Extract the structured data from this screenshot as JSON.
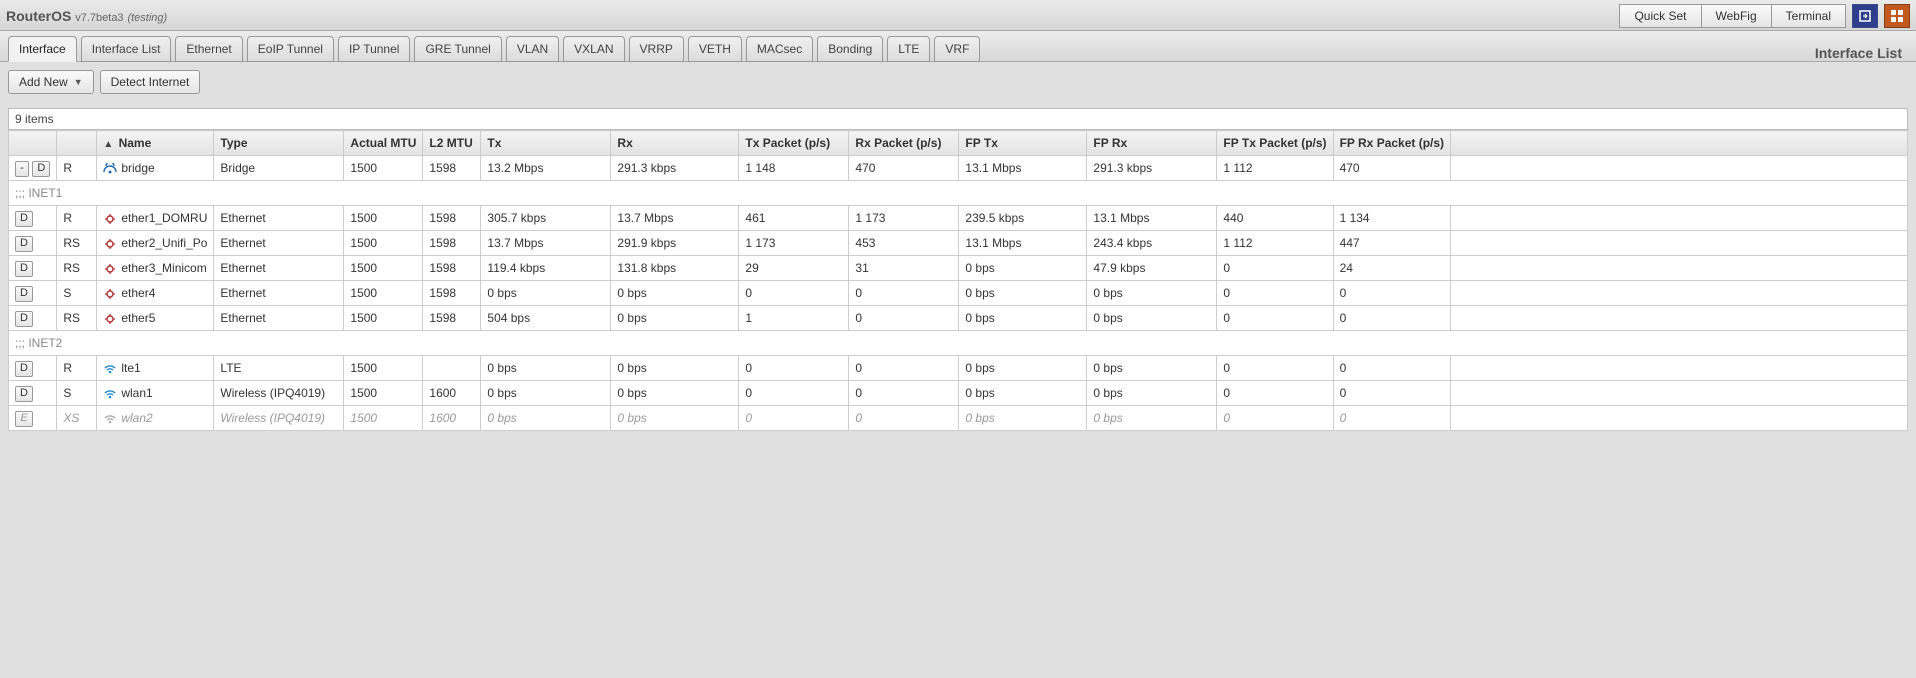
{
  "brand_name": "RouterOS",
  "brand_ver": "v7.7beta3",
  "brand_tag": "(testing)",
  "topbuttons": [
    "Quick Set",
    "WebFig",
    "Terminal"
  ],
  "page_title": "Interface List",
  "tabs": [
    "Interface",
    "Interface List",
    "Ethernet",
    "EoIP Tunnel",
    "IP Tunnel",
    "GRE Tunnel",
    "VLAN",
    "VXLAN",
    "VRRP",
    "VETH",
    "MACsec",
    "Bonding",
    "LTE",
    "VRF"
  ],
  "active_tab": 0,
  "toolbar": {
    "addnew": "Add New",
    "detect": "Detect Internet"
  },
  "count_label": "9 items",
  "columns": [
    "",
    "",
    "▲ Name",
    "Type",
    "Actual MTU",
    "L2 MTU",
    "Tx",
    "Rx",
    "Tx Packet (p/s)",
    "Rx Packet (p/s)",
    "FP Tx",
    "FP Rx",
    "FP Tx Packet (p/s)",
    "FP Rx Packet (p/s)",
    ""
  ],
  "sections": [
    {
      "rows": [
        {
          "flags": [
            "-",
            "D"
          ],
          "stat": "R",
          "icon": "bridge",
          "name": "bridge",
          "type": "Bridge",
          "amtu": "1500",
          "l2mtu": "1598",
          "tx": "13.2 Mbps",
          "rx": "291.3 kbps",
          "txp": "1 148",
          "rxp": "470",
          "fptx": "13.1 Mbps",
          "fprx": "291.3 kbps",
          "fptxp": "1 112",
          "fprxp": "470",
          "disabled": false
        }
      ]
    },
    {
      "label": ";;; INET1",
      "rows": [
        {
          "flags": [
            "D"
          ],
          "stat": "R",
          "icon": "eth",
          "name": "ether1_DOMRU",
          "type": "Ethernet",
          "amtu": "1500",
          "l2mtu": "1598",
          "tx": "305.7 kbps",
          "rx": "13.7 Mbps",
          "txp": "461",
          "rxp": "1 173",
          "fptx": "239.5 kbps",
          "fprx": "13.1 Mbps",
          "fptxp": "440",
          "fprxp": "1 134",
          "disabled": false
        },
        {
          "flags": [
            "D"
          ],
          "stat": "RS",
          "icon": "eth",
          "name": "ether2_Unifi_Po",
          "type": "Ethernet",
          "amtu": "1500",
          "l2mtu": "1598",
          "tx": "13.7 Mbps",
          "rx": "291.9 kbps",
          "txp": "1 173",
          "rxp": "453",
          "fptx": "13.1 Mbps",
          "fprx": "243.4 kbps",
          "fptxp": "1 112",
          "fprxp": "447",
          "disabled": false
        },
        {
          "flags": [
            "D"
          ],
          "stat": "RS",
          "icon": "eth",
          "name": "ether3_Minicom",
          "type": "Ethernet",
          "amtu": "1500",
          "l2mtu": "1598",
          "tx": "119.4 kbps",
          "rx": "131.8 kbps",
          "txp": "29",
          "rxp": "31",
          "fptx": "0 bps",
          "fprx": "47.9 kbps",
          "fptxp": "0",
          "fprxp": "24",
          "disabled": false
        },
        {
          "flags": [
            "D"
          ],
          "stat": "S",
          "icon": "eth",
          "name": "ether4",
          "type": "Ethernet",
          "amtu": "1500",
          "l2mtu": "1598",
          "tx": "0 bps",
          "rx": "0 bps",
          "txp": "0",
          "rxp": "0",
          "fptx": "0 bps",
          "fprx": "0 bps",
          "fptxp": "0",
          "fprxp": "0",
          "disabled": false
        },
        {
          "flags": [
            "D"
          ],
          "stat": "RS",
          "icon": "eth",
          "name": "ether5",
          "type": "Ethernet",
          "amtu": "1500",
          "l2mtu": "1598",
          "tx": "504 bps",
          "rx": "0 bps",
          "txp": "1",
          "rxp": "0",
          "fptx": "0 bps",
          "fprx": "0 bps",
          "fptxp": "0",
          "fprxp": "0",
          "disabled": false
        }
      ]
    },
    {
      "label": ";;; INET2",
      "rows": [
        {
          "flags": [
            "D"
          ],
          "stat": "R",
          "icon": "wl",
          "name": "lte1",
          "type": "LTE",
          "amtu": "1500",
          "l2mtu": "",
          "tx": "0 bps",
          "rx": "0 bps",
          "txp": "0",
          "rxp": "0",
          "fptx": "0 bps",
          "fprx": "0 bps",
          "fptxp": "0",
          "fprxp": "0",
          "disabled": false
        },
        {
          "flags": [
            "D"
          ],
          "stat": "S",
          "icon": "wl",
          "name": "wlan1",
          "type": "Wireless (IPQ4019)",
          "amtu": "1500",
          "l2mtu": "1600",
          "tx": "0 bps",
          "rx": "0 bps",
          "txp": "0",
          "rxp": "0",
          "fptx": "0 bps",
          "fprx": "0 bps",
          "fptxp": "0",
          "fprxp": "0",
          "disabled": false
        },
        {
          "flags": [
            "E"
          ],
          "stat": "XS",
          "icon": "wl-grey",
          "name": "wlan2",
          "type": "Wireless (IPQ4019)",
          "amtu": "1500",
          "l2mtu": "1600",
          "tx": "0 bps",
          "rx": "0 bps",
          "txp": "0",
          "rxp": "0",
          "fptx": "0 bps",
          "fprx": "0 bps",
          "fptxp": "0",
          "fprxp": "0",
          "disabled": true
        }
      ]
    }
  ]
}
